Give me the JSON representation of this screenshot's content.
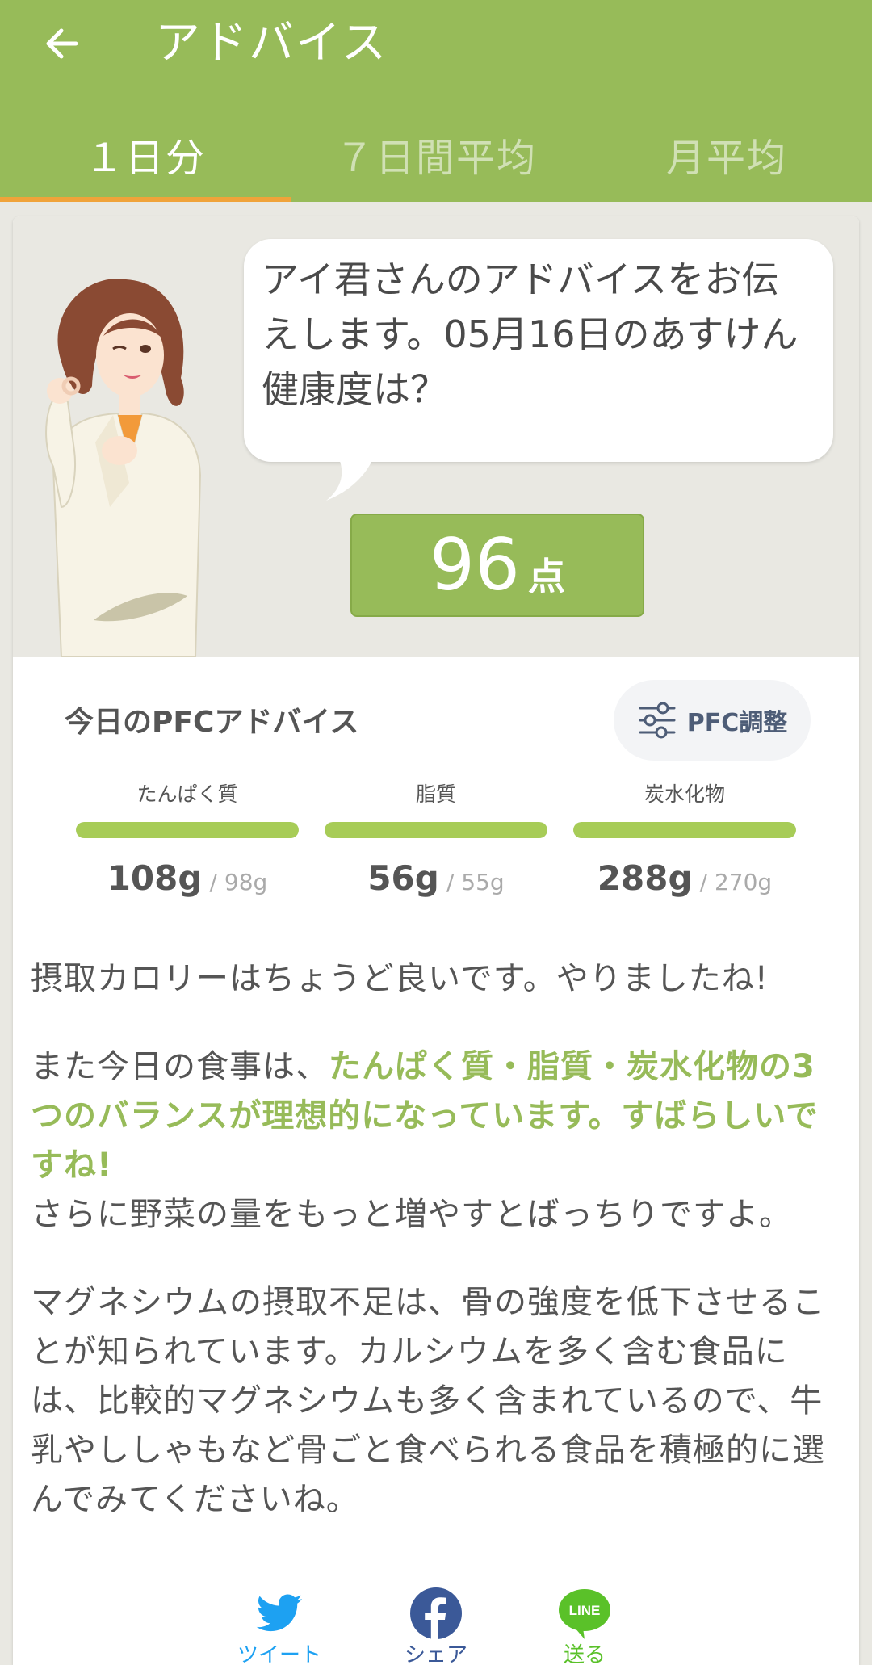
{
  "header": {
    "title": "アドバイス",
    "back_icon": "arrow-left-icon"
  },
  "tabs": [
    {
      "label": "１日分",
      "active": true
    },
    {
      "label": "７日間平均",
      "active": false
    },
    {
      "label": "月平均",
      "active": false
    }
  ],
  "speech": {
    "text": "アイ君さんのアドバイスをお伝えします。05月16日のあすけん健康度は？"
  },
  "score": {
    "value": "96",
    "unit": "点"
  },
  "pfc": {
    "title": "今日のPFCアドバイス",
    "adjust_label": "PFC調整",
    "adjust_icon": "sliders-icon",
    "items": [
      {
        "label": "たんぱく質",
        "actual": "108",
        "target": "/ 98",
        "unit": "g",
        "fill_fraction": 1.0
      },
      {
        "label": "脂質",
        "actual": "56",
        "target": "/ 55",
        "unit": "g",
        "fill_fraction": 1.0
      },
      {
        "label": "炭水化物",
        "actual": "288",
        "target": "/ 270",
        "unit": "g",
        "fill_fraction": 1.0
      }
    ]
  },
  "advice": {
    "p1": "摂取カロリーはちょうど良いです。やりましたね!",
    "p2_lead": "また今日の食事は、",
    "p2_highlight": "たんぱく質・脂質・炭水化物の3つのバランスが理想的になっています。すばらしいですね!",
    "p2_tail": "さらに野菜の量をもっと増やすとばっちりですよ。",
    "p3": "マグネシウムの摂取不足は、骨の強度を低下させることが知られています。カルシウムを多く含む食品には、比較的マグネシウムも多く含まれているので、牛乳やししゃもなど骨ごと食べられる食品を積極的に選んでみてくださいね。"
  },
  "share": {
    "twitter_label": "ツイート",
    "facebook_label": "シェア",
    "line_label": "送る",
    "line_icon_text": "LINE"
  },
  "colors": {
    "brand_green": "#97bb59",
    "tab_indicator": "#f0a33a",
    "twitter": "#1da1f2",
    "facebook": "#3b5998",
    "line": "#5ac129"
  }
}
